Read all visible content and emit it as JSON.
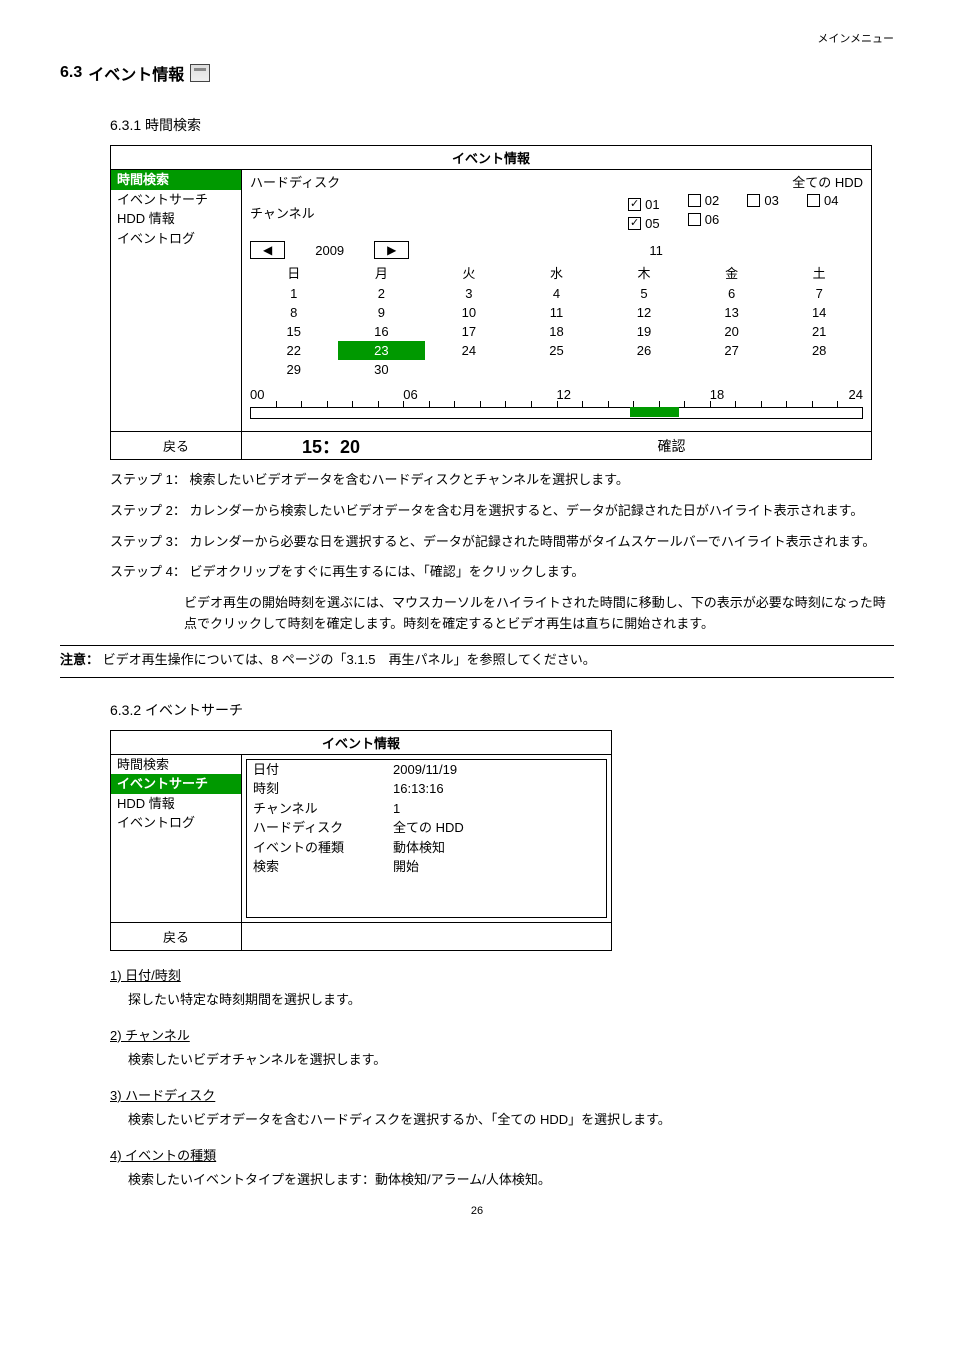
{
  "header_right": "メインメニュー",
  "section": {
    "num": "6.3",
    "title": "イベント情報"
  },
  "s631": {
    "num": "6.3.1",
    "title": "時間検索"
  },
  "ev_title": "イベント情報",
  "side1": [
    "時間検索",
    "イベントサーチ",
    "HDD 情報",
    "イベントログ"
  ],
  "r_hdd_label": "ハードディスク",
  "r_hdd_val": "全ての HDD",
  "r_ch_label": "チャンネル",
  "ch": [
    "01",
    "02",
    "03",
    "04",
    "05",
    "06"
  ],
  "cal": {
    "year": "2009",
    "month": "11",
    "days_head": [
      "日",
      "月",
      "火",
      "水",
      "木",
      "金",
      "土"
    ],
    "rows": [
      [
        "",
        "",
        "",
        "",
        "",
        "",
        ""
      ],
      [
        "1",
        "2",
        "3",
        "4",
        "5",
        "6",
        "7"
      ],
      [
        "8",
        "9",
        "10",
        "11",
        "12",
        "13",
        "14"
      ],
      [
        "15",
        "16",
        "17",
        "18",
        "19",
        "20",
        "21"
      ],
      [
        "22",
        "23",
        "24",
        "25",
        "26",
        "27",
        "28"
      ],
      [
        "29",
        "30",
        "",
        "",
        "",
        "",
        ""
      ]
    ],
    "hl_row": 4,
    "hl_col": 1
  },
  "tl": {
    "labels": [
      "00",
      "06",
      "12",
      "18",
      "24"
    ]
  },
  "back_label": "戻る",
  "big_time": "15：20",
  "confirm_label": "確認",
  "step1": "ステップ 1： 検索したいビデオデータを含むハードディスクとチャンネルを選択します。",
  "step2": "ステップ 2： カレンダーから検索したいビデオデータを含む月を選択すると、データが記録された日がハイライト表示されます。",
  "step3": "ステップ 3： カレンダーから必要な日を選択すると、データが記録された時間帯がタイムスケールバーでハイライト表示されます。",
  "step4a": "ステップ 4： ビデオクリップをすぐに再生するには、「確認」をクリックします。",
  "step4b": "ビデオ再生の開始時刻を選ぶには、マウスカーソルをハイライトされた時間に移動し、下の表示が必要な時刻になった時点でクリックして時刻を確定します。時刻を確定するとビデオ再生は直ちに開始されます。",
  "note_label": "注意：",
  "note_body": " ビデオ再生操作については、8 ページの「3.1.5　再生パネル」を参照してください。",
  "s632": {
    "num": "6.3.2",
    "title": "イベントサーチ"
  },
  "side2": [
    "時間検索",
    "イベントサーチ",
    "HDD 情報",
    "イベントログ"
  ],
  "kv": {
    "date_k": "日付",
    "date_v": "2009/11/19",
    "time_k": "時刻",
    "time_v": "16:13:16",
    "ch_k": "チャンネル",
    "ch_v": "1",
    "hdd_k": "ハードディスク",
    "hdd_v": "全ての HDD",
    "type_k": "イベントの種類",
    "type_v": "動体検知",
    "search_k": "検索",
    "search_v": "開始"
  },
  "list": {
    "n1_t": "1)  日付/時刻",
    "n1_b": "探したい特定な時刻期間を選択します。",
    "n2_t": "2)  チャンネル",
    "n2_b": "検索したいビデオチャンネルを選択します。",
    "n3_t": "3)  ハードディスク",
    "n3_b": "検索したいビデオデータを含むハードディスクを選択するか、「全ての HDD」を選択します。",
    "n4_t": "4)  イベントの種類",
    "n4_b": "検索したいイベントタイプを選択します：動体検知/アラーム/人体検知。"
  },
  "pagenum": "26"
}
